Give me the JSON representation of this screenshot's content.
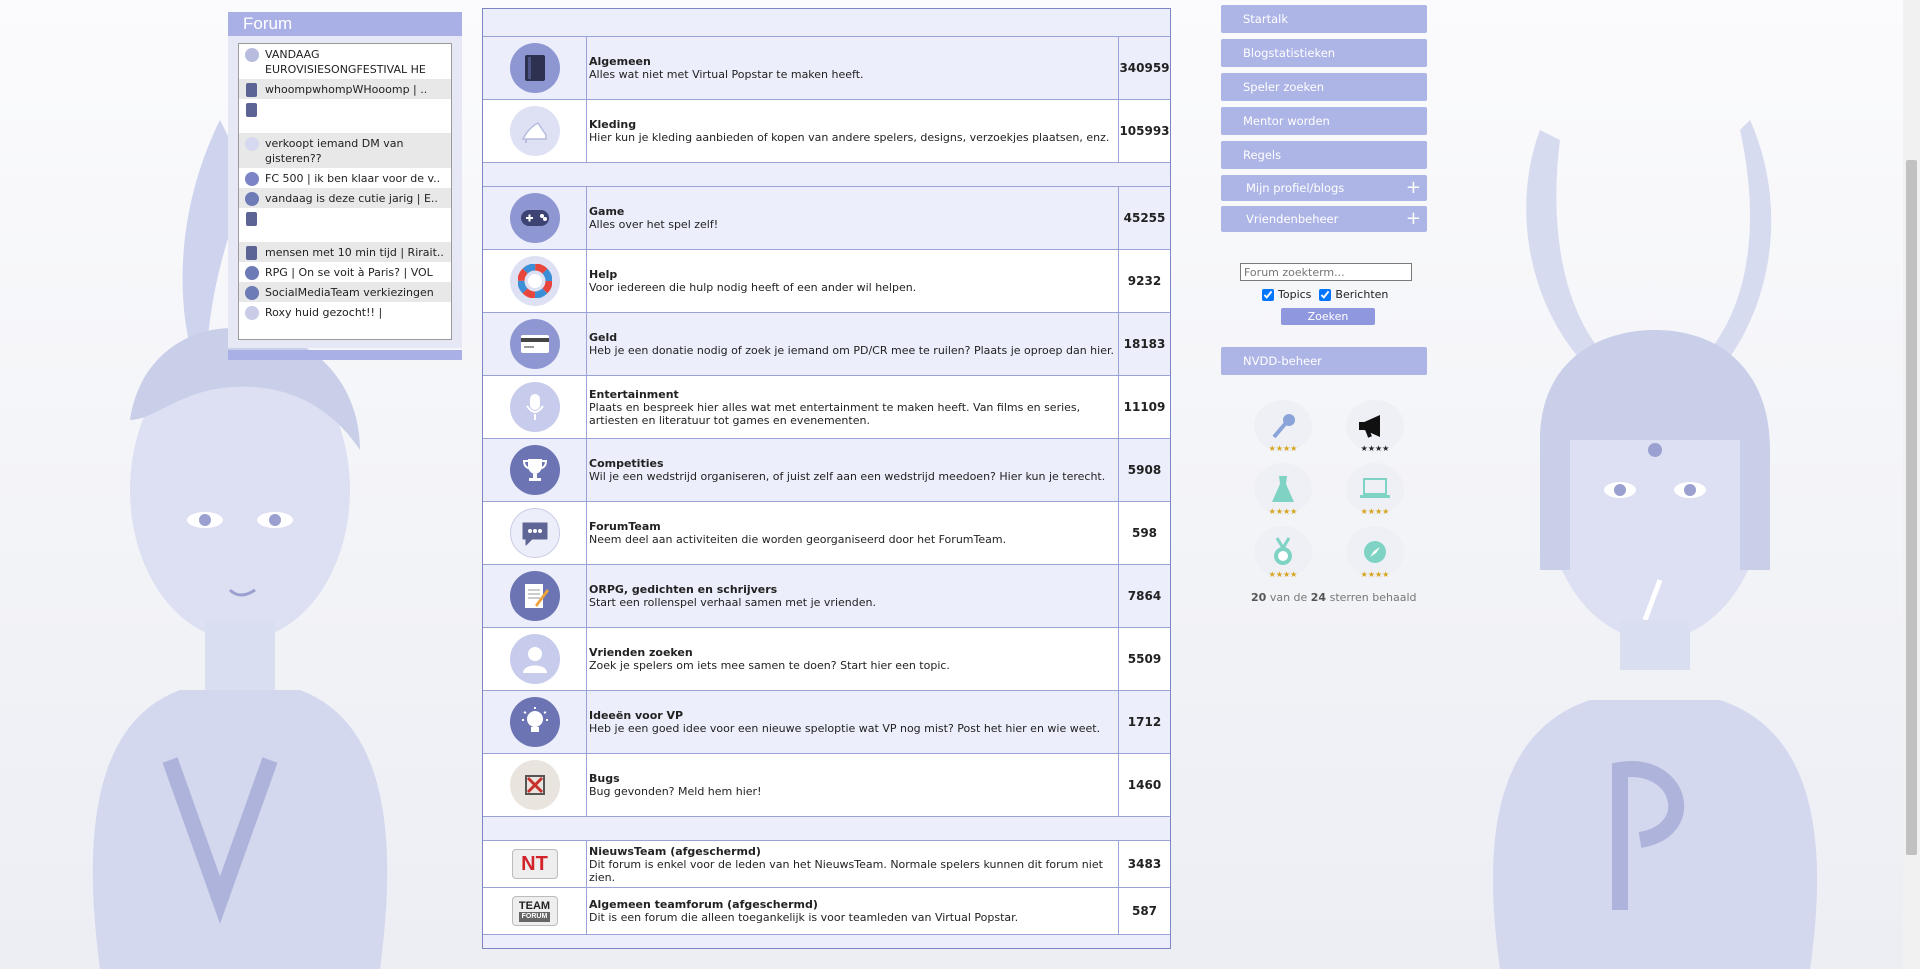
{
  "forum_widget": {
    "title": "Forum",
    "items": [
      {
        "text": "VANDAAG EUROVISIESONGFESTIVAL HE",
        "icon": "clock-icon"
      },
      {
        "text": "whoompwhompWHooomp | ..",
        "icon": "book-icon"
      },
      {
        "text": "",
        "icon": "book-icon"
      },
      {
        "text": "verkoopt iemand DM van gisteren??",
        "icon": "shoe-icon"
      },
      {
        "text": "FC 500 | ik ben klaar voor de v..",
        "icon": "trophy-icon"
      },
      {
        "text": "vandaag is deze cutie jarig | E..",
        "icon": "gamepad-icon"
      },
      {
        "text": "",
        "icon": "book-icon"
      },
      {
        "text": "mensen met 10 min tijd | Rirait..",
        "icon": "book-icon"
      },
      {
        "text": "RPG | On se voit à Paris? | VOL",
        "icon": "pad-icon"
      },
      {
        "text": "SocialMediaTeam verkiezingen",
        "icon": "gamepad-icon"
      },
      {
        "text": "Roxy huid gezocht!! |",
        "icon": "bubble-icon"
      }
    ]
  },
  "forums": {
    "group1": [
      {
        "title": "Algemeen",
        "desc": "Alles wat niet met Virtual Popstar te maken heeft.",
        "count": "340959",
        "icon": "book-icon",
        "style": "dark"
      },
      {
        "title": "Kleding",
        "desc": "Hier kun je kleding aanbieden of kopen van andere spelers, designs, verzoekjes plaatsen, enz.",
        "count": "105993",
        "icon": "high-heel-icon",
        "style": "light"
      }
    ],
    "group2": [
      {
        "title": "Game",
        "desc": "Alles over het spel zelf!",
        "count": "45255",
        "icon": "gamepad-icon",
        "style": "dark"
      },
      {
        "title": "Help",
        "desc": "Voor iedereen die hulp nodig heeft of een ander wil helpen.",
        "count": "9232",
        "icon": "lifebuoy-icon",
        "style": "light"
      },
      {
        "title": "Geld",
        "desc": "Heb je een donatie nodig of zoek je iemand om PD/CR mee te ruilen? Plaats je oproep dan hier.",
        "count": "18183",
        "icon": "credit-card-icon",
        "style": "dark"
      },
      {
        "title": "Entertainment",
        "desc": "Plaats en bespreek hier alles wat met entertainment te maken heeft. Van films en series, artiesten en literatuur tot games en evenementen.",
        "count": "11109",
        "icon": "microphone-icon",
        "style": "light"
      },
      {
        "title": "Competities",
        "desc": "Wil je een wedstrijd organiseren, of juist zelf aan een wedstrijd meedoen? Hier kun je terecht.",
        "count": "5908",
        "icon": "trophy-icon",
        "style": "dark"
      },
      {
        "title": "ForumTeam",
        "desc": "Neem deel aan activiteiten die worden georganiseerd door het ForumTeam.",
        "count": "598",
        "icon": "speech-bubble-icon",
        "style": "light"
      },
      {
        "title": "ORPG, gedichten en schrijvers",
        "desc": "Start een rollenspel verhaal samen met je vrienden.",
        "count": "7864",
        "icon": "notepad-icon",
        "style": "dark"
      },
      {
        "title": "Vrienden zoeken",
        "desc": "Zoek je spelers om iets mee samen te doen? Start hier een topic.",
        "count": "5509",
        "icon": "person-icon",
        "style": "light"
      },
      {
        "title": "Ideeën voor VP",
        "desc": "Heb je een goed idee voor een nieuwe speloptie wat VP nog mist? Post het hier en wie weet.",
        "count": "1712",
        "icon": "lightbulb-icon",
        "style": "dark"
      },
      {
        "title": "Bugs",
        "desc": "Bug gevonden? Meld hem hier!",
        "count": "1460",
        "icon": "bug-icon",
        "style": "light"
      }
    ],
    "group3": [
      {
        "title": "NieuwsTeam (afgeschermd)",
        "desc": "Dit forum is enkel voor de leden van het NieuwsTeam. Normale spelers kunnen dit forum niet zien.",
        "count": "3483",
        "badge": "NT",
        "icon": "nt-badge-icon"
      },
      {
        "title": "Algemeen teamforum (afgeschermd)",
        "desc": "Dit is een forum die alleen toegankelijk is voor teamleden van Virtual Popstar.",
        "count": "587",
        "badge_top": "TEAM",
        "badge_bottom": "FORUM",
        "icon": "team-forum-badge-icon"
      }
    ]
  },
  "menu": {
    "items": [
      "Startalk",
      "Blogstatistieken",
      "Speler zoeken",
      "Mentor worden",
      "Regels"
    ],
    "expandable": [
      "Mijn profiel/blogs",
      "Vriendenbeheer"
    ],
    "plus": "+",
    "nvdd": "NVDD-beheer"
  },
  "search": {
    "placeholder": "Forum zoekterm...",
    "topics_label": "Topics",
    "berichten_label": "Berichten",
    "button": "Zoeken"
  },
  "stars": {
    "badges": [
      "microphone-icon",
      "megaphone-icon",
      "dress-icon",
      "laptop-icon",
      "medal-icon",
      "compass-icon"
    ],
    "star_glyphs": "★★★★",
    "achieved": "20",
    "total": "24",
    "van_de": "van de",
    "sterren_behaald": "sterren behaald"
  },
  "colors": {
    "accent": "#adb4e6",
    "icon_dark": "#8f97d3",
    "icon_light": "#dee1f3",
    "star": "#d6a41c"
  }
}
